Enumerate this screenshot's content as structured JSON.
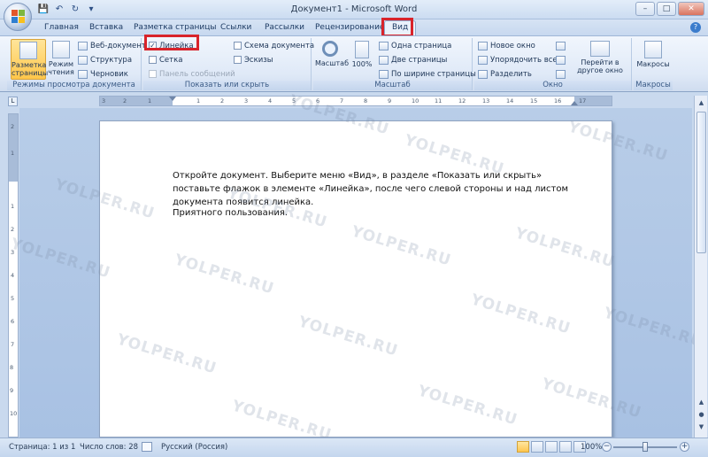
{
  "window": {
    "title": "Документ1 - Microsoft Word",
    "controls": {
      "minimize": "–",
      "maximize": "□",
      "close": "✕"
    }
  },
  "qat": {
    "save_icon": "💾",
    "undo_icon": "↶",
    "redo_icon": "↻",
    "customize_icon": "▾"
  },
  "tabs": [
    {
      "label": "Главная"
    },
    {
      "label": "Вставка"
    },
    {
      "label": "Разметка страницы"
    },
    {
      "label": "Ссылки"
    },
    {
      "label": "Рассылки"
    },
    {
      "label": "Рецензирование"
    },
    {
      "label": "Вид",
      "active": true
    }
  ],
  "help_label": "?",
  "ribbon": {
    "views": {
      "label": "Режимы просмотра документа",
      "print_layout": "Разметка страницы",
      "full_screen": "Режим чтения",
      "web": "Веб-документ",
      "outline": "Структура",
      "draft": "Черновик"
    },
    "show_hide": {
      "label": "Показать или скрыть",
      "ruler": {
        "label": "Линейка",
        "checked": true
      },
      "gridlines": {
        "label": "Сетка",
        "checked": false
      },
      "message_bar": {
        "label": "Панель сообщений",
        "checked": false,
        "disabled": true
      },
      "doc_map": {
        "label": "Схема документа",
        "checked": false
      },
      "thumbnails": {
        "label": "Эскизы",
        "checked": false
      }
    },
    "zoom": {
      "label": "Масштаб",
      "zoom_btn": "Масштаб",
      "hundred": "100%",
      "one_page": "Одна страница",
      "two_pages": "Две страницы",
      "page_width": "По ширине страницы"
    },
    "window_group": {
      "label": "Окно",
      "new_window": "Новое окно",
      "arrange_all": "Упорядочить все",
      "split": "Разделить",
      "switch_windows": "Перейти в другое окно"
    },
    "macros": {
      "label": "Макросы",
      "btn": "Макросы"
    }
  },
  "ruler": {
    "corner": "L",
    "h_ticks": [
      "3",
      "2",
      "1",
      "1",
      "2",
      "3",
      "4",
      "5",
      "6",
      "7",
      "8",
      "9",
      "10",
      "11",
      "12",
      "13",
      "14",
      "15",
      "16",
      "17"
    ],
    "v_ticks": [
      "2",
      "1",
      "1",
      "2",
      "3",
      "4",
      "5",
      "6",
      "7",
      "8",
      "9",
      "10",
      "11",
      "12",
      "13",
      "14"
    ]
  },
  "document": {
    "paragraph1": "Откройте документ. Выберите меню «Вид», в разделе «Показать или скрыть» поставьте флажок в элементе «Линейка», после чего слевой стороны и над листом документа появится линейка.",
    "paragraph2": "Приятного пользования."
  },
  "watermark": "YOLPER.RU",
  "status": {
    "page": "Страница: 1 из 1",
    "words": "Число слов: 28",
    "language": "Русский (Россия)",
    "zoom": "100%",
    "zoom_level": 100
  },
  "colors": {
    "highlight": "#d8232a",
    "active_button": "#ffc64a",
    "ribbon_bg": "#dfe9f7"
  }
}
